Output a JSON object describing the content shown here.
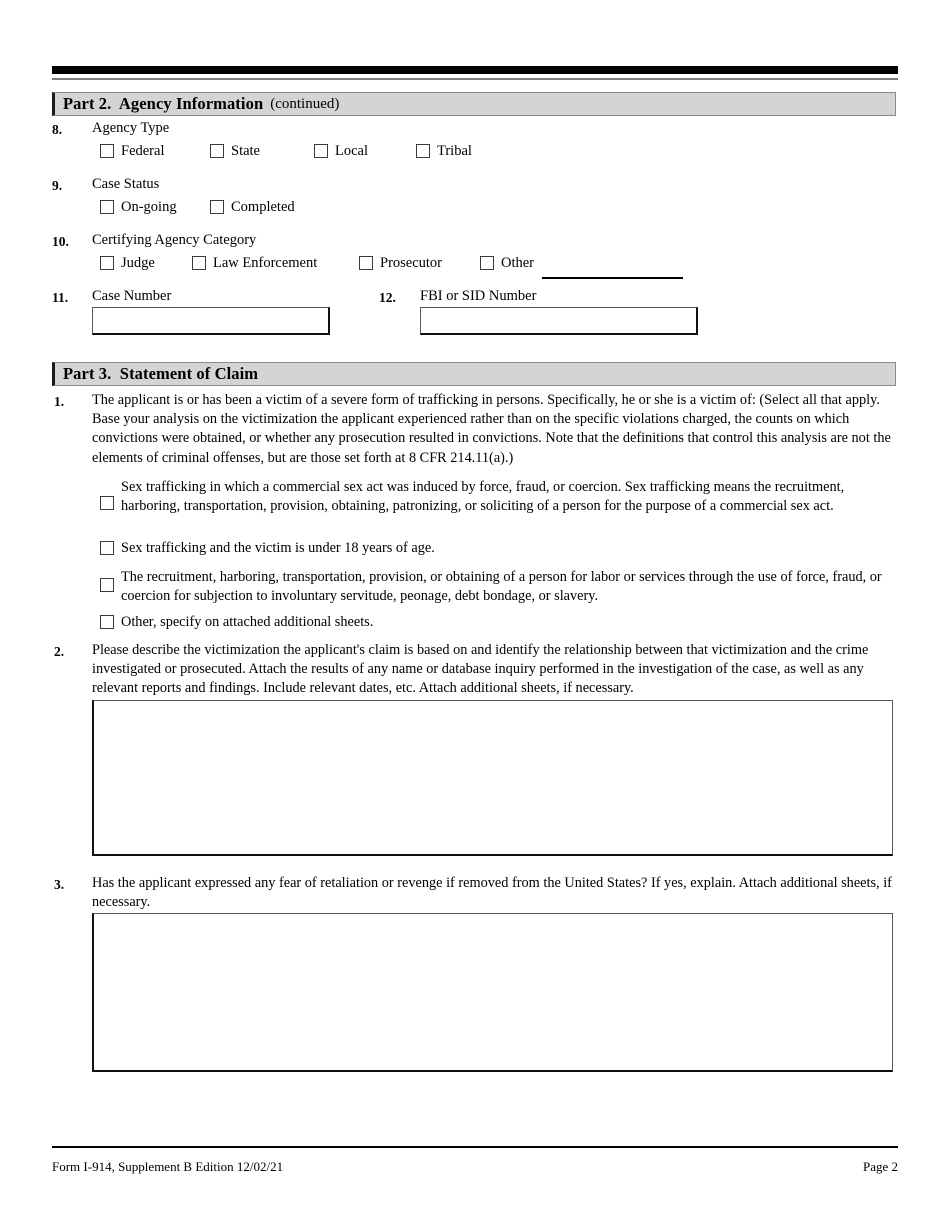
{
  "document": {
    "form_id": "Form I-914, Supplement B",
    "footer_left": "Form I-914, Supplement B   Edition   12/02/21",
    "footer_right": "Page 2"
  },
  "part2": {
    "title": "Part 2.  Agency Information",
    "subtitle": "(continued)",
    "items": [
      {
        "number": "8.",
        "label": "Agency Type",
        "options": [
          {
            "label": "Federal",
            "checked": false
          },
          {
            "label": "State",
            "checked": false
          },
          {
            "label": "Local",
            "checked": false
          },
          {
            "label": "Tribal",
            "checked": false
          }
        ]
      },
      {
        "number": "9.",
        "label": "Case Status",
        "options": [
          {
            "label": "On-going",
            "checked": false
          },
          {
            "label": "Completed",
            "checked": false
          }
        ]
      },
      {
        "number": "10.",
        "label": "Certifying Agency Category",
        "options": [
          {
            "label": "Judge",
            "checked": false
          },
          {
            "label": "Law Enforcement",
            "checked": false
          },
          {
            "label": "Prosecutor",
            "checked": false
          },
          {
            "label": "Other",
            "checked": false
          }
        ],
        "other_value": ""
      },
      {
        "number": "11.",
        "label": "Case Number",
        "value": ""
      },
      {
        "number": "12.",
        "label": "FBI or SID Number",
        "value": ""
      }
    ]
  },
  "part3": {
    "title": "Part 3.  Statement of Claim",
    "item1": {
      "number": "1.",
      "text": "The applicant is or has been a victim of a severe form of trafficking in persons.  Specifically, he or she is a victim of: (Select all that apply.  Base your analysis on the victimization the applicant experienced rather than on the specific violations charged, the counts on which convictions were obtained, or whether any prosecution resulted in convictions.  Note that the definitions that control this analysis are not the elements of criminal offenses, but are those set forth at 8 CFR 214.11(a).)",
      "options": [
        {
          "label": "Sex trafficking in which a commercial sex act was induced by force, fraud, or coercion. Sex trafficking means the recruitment, harboring, transportation, provision, obtaining, patronizing, or soliciting of a person for the purpose of a commercial sex act.",
          "checked": false
        },
        {
          "label": "Sex trafficking and the victim is under 18 years of age.",
          "checked": false
        },
        {
          "label": "The recruitment, harboring, transportation, provision, or obtaining of a person for labor or services through the use of force, fraud, or coercion for subjection to involuntary servitude, peonage, debt bondage, or slavery.",
          "checked": false
        },
        {
          "label": "Other, specify on attached additional sheets.",
          "checked": false
        }
      ]
    },
    "item2": {
      "number": "2.",
      "text": "Please describe the victimization the applicant's claim is based on and identify the relationship between that victimization and the crime investigated or prosecuted.  Attach the results of any name or database inquiry performed in the investigation of the case, as well as any relevant reports and findings.  Include relevant dates, etc.  Attach additional sheets, if necessary.",
      "value": ""
    },
    "item3": {
      "number": "3.",
      "text": "Has the applicant expressed any fear of retaliation or revenge if removed from the United States? If yes, explain. Attach additional sheets, if necessary.",
      "value": ""
    }
  },
  "colors": {
    "band_background": "#d4d4d4",
    "band_border": "#8a8a8a",
    "rule_black": "#000000",
    "rule_gray": "#7f7f7f",
    "text": "#000000"
  }
}
